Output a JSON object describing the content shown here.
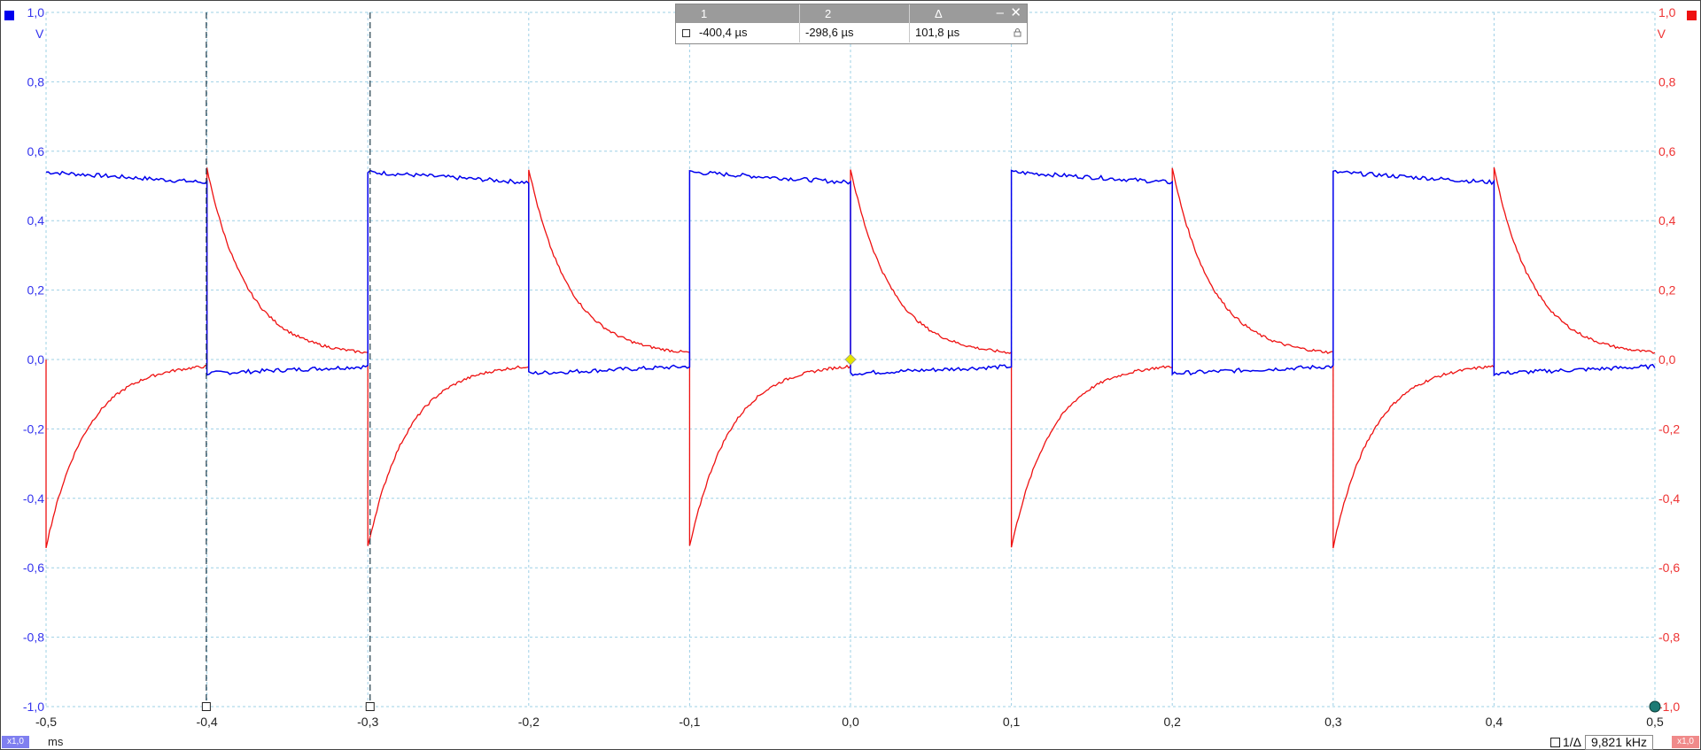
{
  "colors": {
    "channel_a": "#0000ee",
    "channel_b": "#ee1111",
    "grid": "#9ed0e6",
    "trigger": "#e6e600",
    "ruler": "#1f3b4a"
  },
  "cursor_panel": {
    "col1_header": "1",
    "col2_header": "2",
    "col3_header": "Δ",
    "col1_value": "-400,4 µs",
    "col2_value": "-298,6 µs",
    "col3_value": "101,8 µs",
    "minimize_label": "‒",
    "close_label": "✕",
    "lock_icon": "lock-icon"
  },
  "bottom_bar": {
    "channel_a_scale": "x1,0",
    "channel_b_scale": "x1,0",
    "time_units": "ms",
    "freq_label": "1/Δ",
    "freq_value": "9,821 kHz"
  },
  "chart_data": {
    "type": "line",
    "title": "",
    "xlabel": "ms",
    "xlim": [
      -0.5,
      0.5
    ],
    "x_ticks": [
      "-0,5",
      "-0,4",
      "-0,3",
      "-0,2",
      "-0,1",
      "0,0",
      "0,1",
      "0,2",
      "0,3",
      "0,4",
      "0,5"
    ],
    "left_axis": {
      "unit": "V",
      "ylim": [
        -1.0,
        1.0
      ],
      "ticks": [
        "1,0",
        "0,8",
        "0,6",
        "0,4",
        "0,2",
        "0,0",
        "-0,2",
        "-0,4",
        "-0,6",
        "-0,8",
        "-1,0"
      ]
    },
    "right_axis": {
      "unit": "V",
      "ylim": [
        -1.0,
        1.0
      ],
      "ticks": [
        "1,0",
        "0,8",
        "0,6",
        "0,4",
        "0,2",
        "0,0",
        "-0,2",
        "-0,4",
        "-0,6",
        "-0,8",
        "-1,0"
      ]
    },
    "grid": true,
    "ruler_times_ms": [
      -0.4004,
      -0.2986
    ],
    "trigger_point": {
      "x": 0.0,
      "y": 0.0
    },
    "series": [
      {
        "channel": "A",
        "color": "#0000ee",
        "waveform": "square",
        "edges_ms": [
          -0.5,
          -0.4,
          -0.3,
          -0.2,
          -0.1,
          0.0,
          0.1,
          0.2,
          0.3,
          0.4
        ],
        "first_state": "high",
        "high_start": 0.54,
        "high_end": 0.51,
        "low_start": -0.04,
        "low_end": -0.02
      },
      {
        "channel": "B",
        "color": "#ee1111",
        "waveform": "rc-differentiator",
        "edges_ms": [
          -0.5,
          -0.4,
          -0.3,
          -0.2,
          -0.1,
          0.0,
          0.1,
          0.2,
          0.3,
          0.4
        ],
        "first_state": "low",
        "peak_pos": 0.55,
        "peak_neg": -0.54,
        "tau_ms": 0.025,
        "settle": 0.01
      }
    ]
  }
}
